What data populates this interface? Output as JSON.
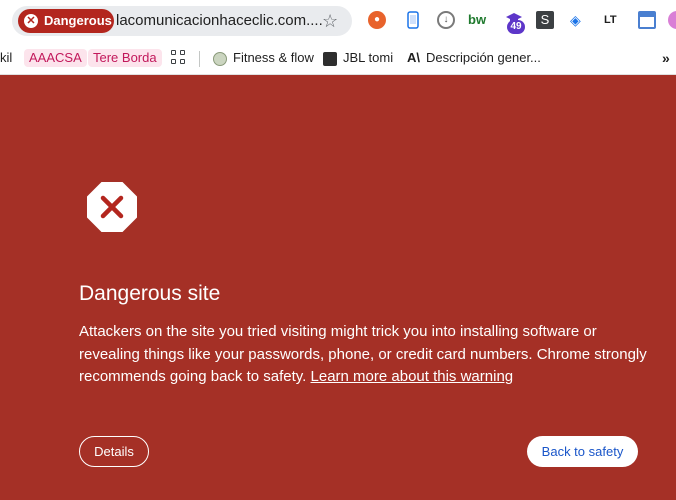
{
  "omnibox": {
    "danger_label": "Dangerous",
    "url": "lacomunicacionhaceclic.com...."
  },
  "extensions": {
    "badge_count": "49",
    "s_label": "S",
    "lt_label": "LT",
    "bw_label": "bw"
  },
  "bookmarks": [
    {
      "label": "kil"
    },
    {
      "label": "AAACSA"
    },
    {
      "label": "Tere Borda"
    },
    {
      "label": "Fitness & flow"
    },
    {
      "label": "JBL tomi"
    },
    {
      "label": "Descripción gener..."
    }
  ],
  "bookmarks_more": "»",
  "interstitial": {
    "title": "Dangerous site",
    "body": "Attackers on the site you tried visiting might trick you into installing software or revealing things like your passwords, phone, or credit card numbers. Chrome strongly recommends going back to safety.",
    "learn_more": "Learn more about this warning",
    "details_button": "Details",
    "back_button": "Back to safety"
  },
  "colors": {
    "background": "#a53026",
    "danger_chip": "#b3261e",
    "link_blue": "#1a56c9"
  }
}
